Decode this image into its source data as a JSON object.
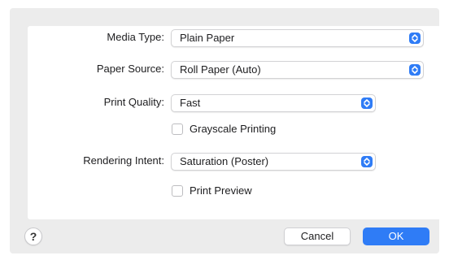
{
  "form": {
    "media_type": {
      "label": "Media Type:",
      "value": "Plain Paper"
    },
    "paper_source": {
      "label": "Paper Source:",
      "value": "Roll Paper (Auto)"
    },
    "print_quality": {
      "label": "Print Quality:",
      "value": "Fast"
    },
    "grayscale": {
      "label": "Grayscale Printing",
      "checked": false
    },
    "rendering_intent": {
      "label": "Rendering Intent:",
      "value": "Saturation (Poster)"
    },
    "print_preview": {
      "label": "Print Preview",
      "checked": false
    }
  },
  "buttons": {
    "help": "?",
    "cancel": "Cancel",
    "ok": "OK"
  },
  "colors": {
    "accent": "#2f7cf6",
    "dialog_bg": "#ececec",
    "panel_bg": "#ffffff"
  },
  "icons": {
    "popup": "chevron-up-down-icon",
    "help": "question-mark-icon"
  }
}
